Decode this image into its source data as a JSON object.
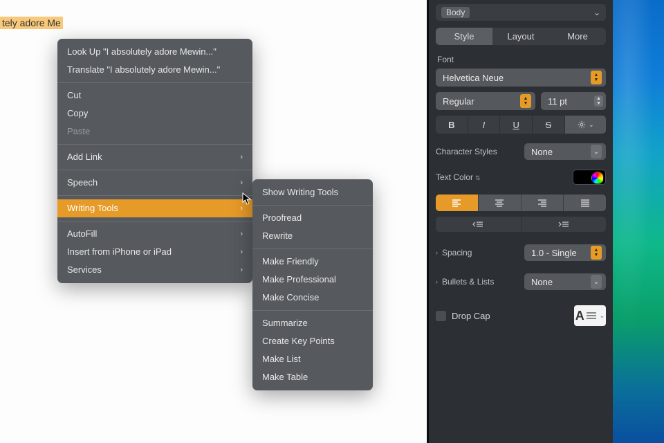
{
  "document": {
    "selected_text": "tely adore Me"
  },
  "context_menu": {
    "look_up": "Look Up \"I absolutely adore Mewin...\"",
    "translate": "Translate \"I absolutely adore Mewin...\"",
    "cut": "Cut",
    "copy": "Copy",
    "paste": "Paste",
    "add_link": "Add Link",
    "speech": "Speech",
    "writing_tools": "Writing Tools",
    "autofill": "AutoFill",
    "insert_from_device": "Insert from iPhone or iPad",
    "services": "Services"
  },
  "writing_tools_submenu": {
    "show": "Show Writing Tools",
    "proofread": "Proofread",
    "rewrite": "Rewrite",
    "make_friendly": "Make Friendly",
    "make_professional": "Make Professional",
    "make_concise": "Make Concise",
    "summarize": "Summarize",
    "create_key_points": "Create Key Points",
    "make_list": "Make List",
    "make_table": "Make Table"
  },
  "inspector": {
    "paragraph_style": "Body",
    "tabs": {
      "style": "Style",
      "layout": "Layout",
      "more": "More"
    },
    "active_tab": "Style",
    "font_label": "Font",
    "font_family": "Helvetica Neue",
    "font_weight": "Regular",
    "font_size": "11 pt",
    "bold": "B",
    "italic": "I",
    "underline": "U",
    "strike": "S",
    "char_styles_label": "Character Styles",
    "char_styles_value": "None",
    "text_color_label": "Text Color",
    "text_color_value": "#000000",
    "alignment": "left",
    "spacing_label": "Spacing",
    "spacing_value": "1.0 - Single",
    "bullets_label": "Bullets & Lists",
    "bullets_value": "None",
    "dropcap_label": "Drop Cap",
    "dropcap_checked": false
  }
}
